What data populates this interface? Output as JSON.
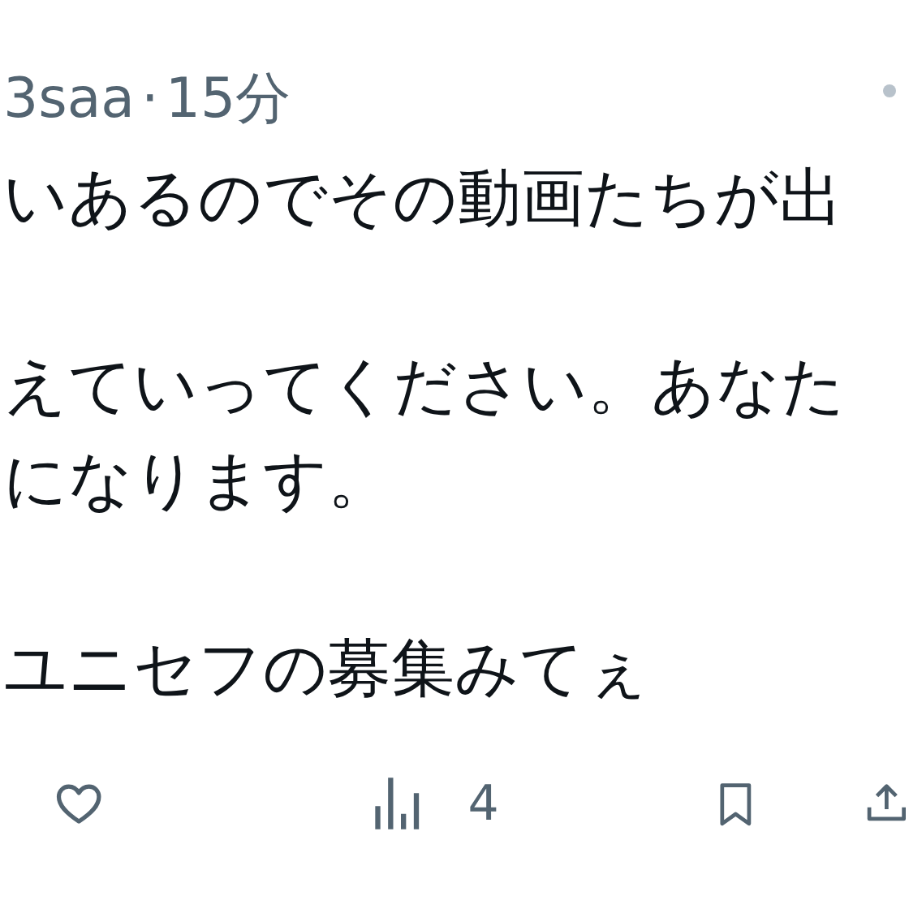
{
  "header": {
    "handle": "3saa",
    "separator": "·",
    "time": "15分"
  },
  "paragraphs": [
    [
      "いあるのでその動画たちが出"
    ],
    [
      "えていってください。あなた",
      "になります。"
    ],
    [
      "ユニセフの募集みてぇ"
    ]
  ],
  "actions": {
    "views": "4"
  }
}
